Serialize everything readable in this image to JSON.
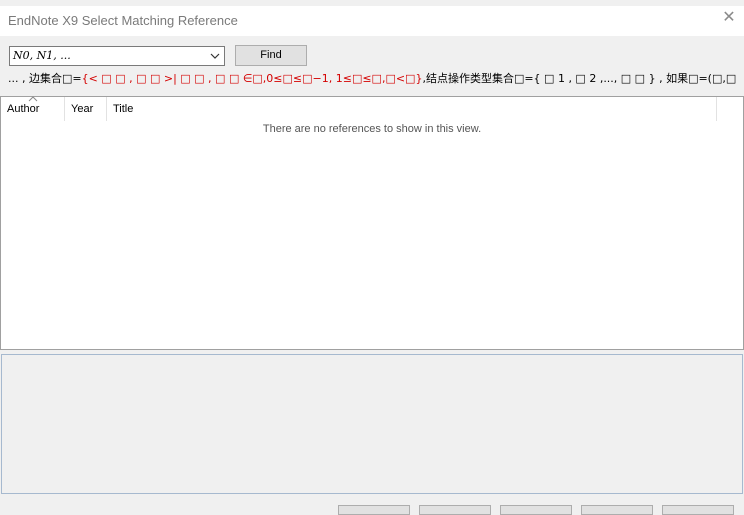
{
  "window": {
    "title": "EndNote X9 Select Matching Reference",
    "close_glyph": "✕"
  },
  "search": {
    "combo_value": "N0, N1, ...",
    "find_label": "Find"
  },
  "formula_line": {
    "prefix": "... , 边集合□=",
    "red_part": "{< □ □ , □ □ >| □ □ , □ □ ∈□,0≤□≤□−1, 1≤□≤□,□<□}",
    "suffix": ",结点操作类型集合□={ □ 1 , □ 2 ,..., □ □ } , 如果□=(□,□"
  },
  "table": {
    "columns": [
      "Author",
      "Year",
      "Title"
    ],
    "empty_message": "There are no references to show in this view."
  },
  "icons": {
    "combo_arrow": "chevron-down-icon",
    "sort": "sort-ascending-icon",
    "close": "close-icon"
  }
}
